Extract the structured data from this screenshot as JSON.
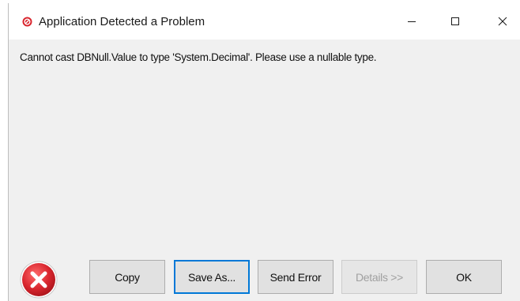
{
  "window": {
    "title": "Application Detected a Problem",
    "icon": "error-circle-icon"
  },
  "message": "Cannot cast DBNull.Value to type 'System.Decimal'. Please use a nullable type.",
  "buttons": {
    "copy": "Copy",
    "save_as": "Save As...",
    "send_error": "Send Error",
    "details": "Details >>",
    "ok": "OK"
  },
  "state": {
    "details_enabled": false,
    "focused_button": "save_as"
  },
  "colors": {
    "error_red": "#d9262e",
    "focus_blue": "#0078d7",
    "dialog_bg": "#f0f0f0"
  }
}
